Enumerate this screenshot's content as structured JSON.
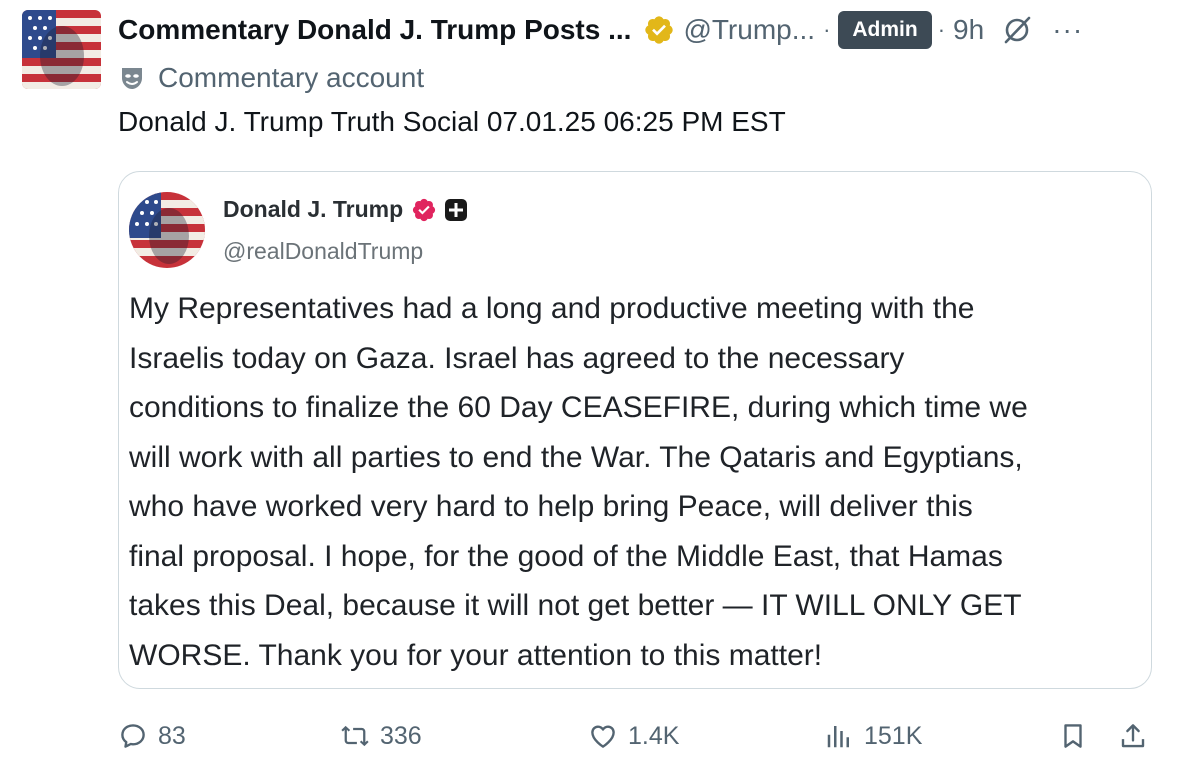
{
  "post": {
    "display_name": "Commentary Donald J. Trump Posts ...",
    "handle": "@Trump...",
    "separator": "·",
    "admin_label": "Admin",
    "time": "9h",
    "more_glyph": "···",
    "commentary_label": "Commentary account",
    "text": "Donald J. Trump Truth Social 07.01.25 06:25 PM EST"
  },
  "quote": {
    "name": "Donald J. Trump",
    "handle": "@realDonaldTrump",
    "lines": [
      "My Representatives had a long and productive meeting with the",
      "Israelis today on Gaza. Israel has agreed to the necessary",
      "conditions to finalize the 60 Day CEASEFIRE, during which time we",
      "will work with all parties to end the War. The Qataris and Egyptians,",
      "who have worked very hard to help bring Peace, will deliver this",
      "final proposal. I hope, for the good of the Middle East, that Hamas",
      "takes this Deal, because it will not get better — IT WILL ONLY GET",
      "WORSE. Thank you for your attention to this matter!"
    ]
  },
  "actions": {
    "replies": "83",
    "reposts": "336",
    "likes": "1.4K",
    "views": "151K"
  },
  "icons": {
    "verified": "gold-verified-badge",
    "quote_verified": "red-verified-badge",
    "grok": "grok-slash-icon",
    "commentary": "commentary-mask-icon",
    "reply": "speech-bubble-icon",
    "repost": "repost-arrows-icon",
    "like": "heart-icon",
    "views": "bar-chart-icon",
    "bookmark": "bookmark-icon",
    "share": "share-icon"
  },
  "colors": {
    "text": "#0f1419",
    "muted": "#536471",
    "admin_bg": "#3d4a55",
    "gold_badge": "#e2b719",
    "red_badge": "#e0245e",
    "border": "#cfd9de"
  }
}
